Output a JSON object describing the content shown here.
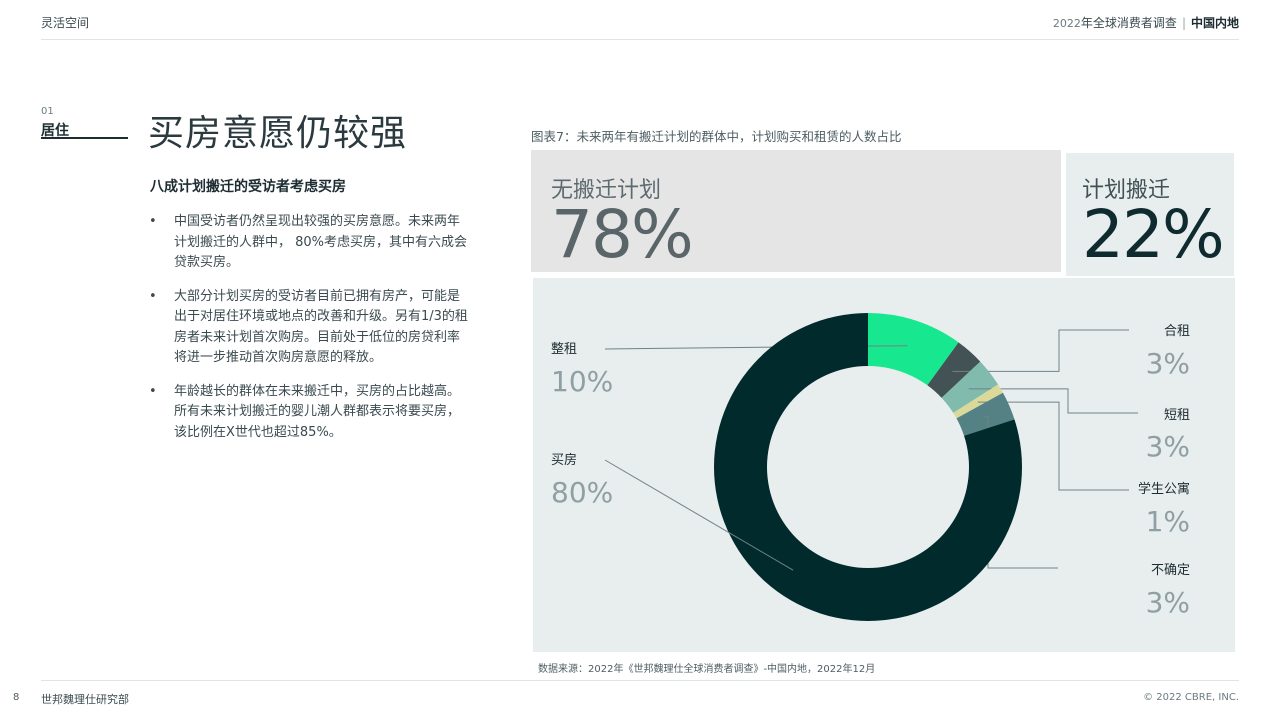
{
  "header": {
    "left": "灵活空间",
    "right_year": "2022",
    "right_title": "年全球消费者调查",
    "right_sep": "|",
    "right_region": "中国内地"
  },
  "section": {
    "number": "01",
    "name": "居住"
  },
  "page_title": "买房意愿仍较强",
  "subtitle": "八成计划搬迁的受访者考虑买房",
  "bullets": [
    {
      "marker": "•",
      "text": "中国受访者仍然呈现出较强的买房意愿。未来两年计划搬迁的人群中， 80%考虑买房，其中有六成会贷款买房。"
    },
    {
      "marker": "•",
      "text": "大部分计划买房的受访者目前已拥有房产，可能是出于对居住环境或地点的改善和升级。另有1/3的租房者未来计划首次购房。目前处于低位的房贷利率将进一步推动首次购房意愿的释放。"
    },
    {
      "marker": "•",
      "text": "年龄越长的群体在未来搬迁中，买房的占比越高。所有未来计划搬迁的婴儿潮人群都表示将要买房，该比例在X世代也超过85%。"
    }
  ],
  "figure_title": "图表7：未来两年有搬迁计划的群体中，计划购买和租赁的人数占比",
  "stats": {
    "no_move_label": "无搬迁计划",
    "no_move_value": "78%",
    "move_label": "计划搬迁",
    "move_value": "22%"
  },
  "chart_data": {
    "type": "pie",
    "subtype": "donut",
    "slices": [
      {
        "label": "整租",
        "value": 10,
        "display": "10%",
        "color": "#17e88f"
      },
      {
        "label": "合租",
        "value": 3,
        "display": "3%",
        "color": "#435254"
      },
      {
        "label": "短租",
        "value": 3,
        "display": "3%",
        "color": "#80bbad"
      },
      {
        "label": "学生公寓",
        "value": 1,
        "display": "1%",
        "color": "#dbd99a"
      },
      {
        "label": "不确定",
        "value": 3,
        "display": "3%",
        "color": "#538184"
      },
      {
        "label": "买房",
        "value": 80,
        "display": "80%",
        "color": "#012a2d"
      }
    ]
  },
  "source": "数据来源：2022年《世邦魏理仕全球消费者调查》-中国内地，2022年12月",
  "footer": {
    "page_number": "8",
    "left": "世邦魏理仕研究部",
    "right": "© 2022 CBRE, INC."
  }
}
